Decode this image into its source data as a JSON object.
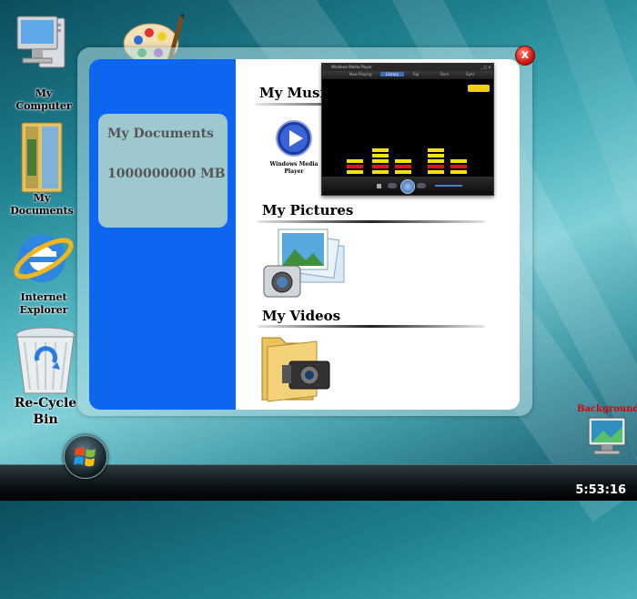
{
  "desktop": {
    "icons": [
      {
        "label_line1": "My",
        "label_line2": "Computer"
      },
      {
        "label_line1": "My",
        "label_line2": "Documents"
      },
      {
        "label_line1": "Internet",
        "label_line2": "Explorer"
      },
      {
        "label_line1": "Re-Cycle",
        "label_line2": "Bin"
      }
    ],
    "background_label": "Background"
  },
  "window": {
    "close_symbol": "x",
    "info_title": "My Documents",
    "info_size": "1000000000 MB",
    "sections": {
      "music": "My Music",
      "pictures": "My Pictures",
      "videos": "My Videos"
    },
    "wmp_icon_label_line1": "Windows Media",
    "wmp_icon_label_line2": "Player"
  },
  "media_player": {
    "title": "Windows Media Player",
    "tabs": [
      "Now Playing",
      "Library",
      "Rip",
      "Burn",
      "Sync"
    ]
  },
  "taskbar": {
    "clock": "5:53:16"
  }
}
